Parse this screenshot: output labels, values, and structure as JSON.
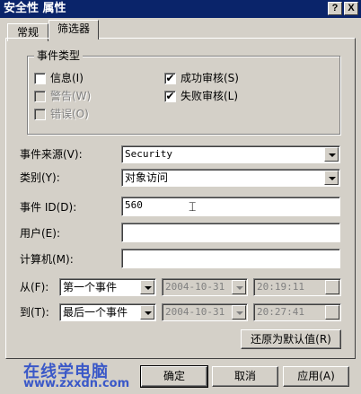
{
  "window": {
    "title": "安全性 属性",
    "help_glyph": "?",
    "close_glyph": "X"
  },
  "tabs": [
    {
      "label": "常规"
    },
    {
      "label": "筛选器"
    }
  ],
  "event_types": {
    "legend": "事件类型",
    "info": {
      "label": "信息(I)",
      "checked": false,
      "enabled": true
    },
    "warning": {
      "label": "警告(W)",
      "checked": false,
      "enabled": false
    },
    "error": {
      "label": "错误(O)",
      "checked": false,
      "enabled": false
    },
    "success_audit": {
      "label": "成功审核(S)",
      "checked": true,
      "enabled": true
    },
    "failure_audit": {
      "label": "失败审核(L)",
      "checked": true,
      "enabled": true
    },
    "check_glyph": "✔"
  },
  "fields": {
    "source_label": "事件来源(V):",
    "source_value": "Security",
    "category_label": "类别(Y):",
    "category_value": "对象访问",
    "event_id_label": "事件 ID(D):",
    "event_id_value": "560",
    "user_label": "用户(E):",
    "user_value": "",
    "computer_label": "计算机(M):",
    "computer_value": ""
  },
  "range": {
    "from_label": "从(F):",
    "from_event": "第一个事件",
    "from_date": "2004-10-31",
    "from_time": "20:19:11",
    "to_label": "到(T):",
    "to_event": "最后一个事件",
    "to_date": "2004-10-31",
    "to_time": "20:27:41"
  },
  "buttons": {
    "restore": "还原为默认值(R)",
    "ok": "确定",
    "cancel": "取消",
    "apply": "应用(A)"
  },
  "watermark": {
    "line1": "在线学电脑",
    "line2": "www.zxxdn.com"
  },
  "colors": {
    "titlebar": "#0a246a",
    "face": "#d4d0c8",
    "watermark": "#3a58c8"
  }
}
